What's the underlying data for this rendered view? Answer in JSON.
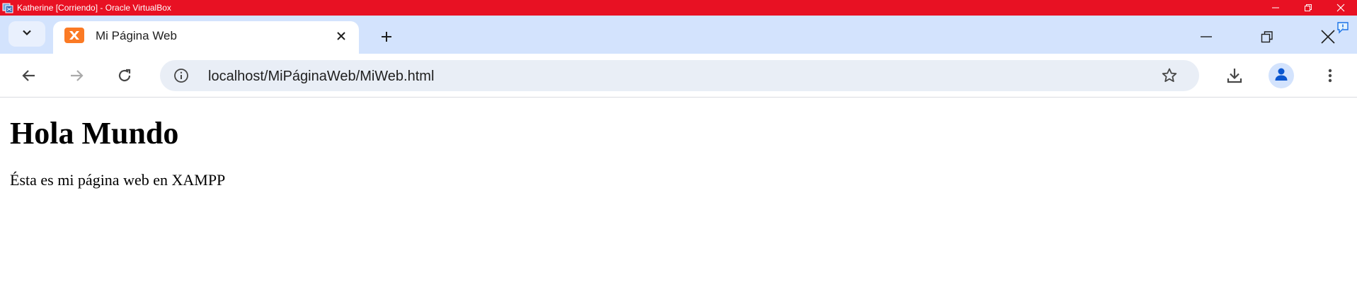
{
  "vbox": {
    "title": "Katherine [Corriendo] - Oracle VirtualBox",
    "icon": "virtualbox-icon",
    "controls": [
      "minimize-icon",
      "restore-icon",
      "close-icon"
    ],
    "color": "#e81123"
  },
  "browser": {
    "tab": {
      "title": "Mi Página Web",
      "favicon": "xampp-icon",
      "favicon_color": "#fb7a24"
    },
    "toolbar": {
      "url": "localhost/MiPáginaWeb/MiWeb.html"
    },
    "colors": {
      "tabstrip": "#d3e3fd",
      "omnibox": "#e9eef6",
      "avatar": "#0b57d0"
    }
  },
  "page": {
    "heading": "Hola Mundo",
    "paragraph": "Ésta es mi página web en XAMPP"
  }
}
